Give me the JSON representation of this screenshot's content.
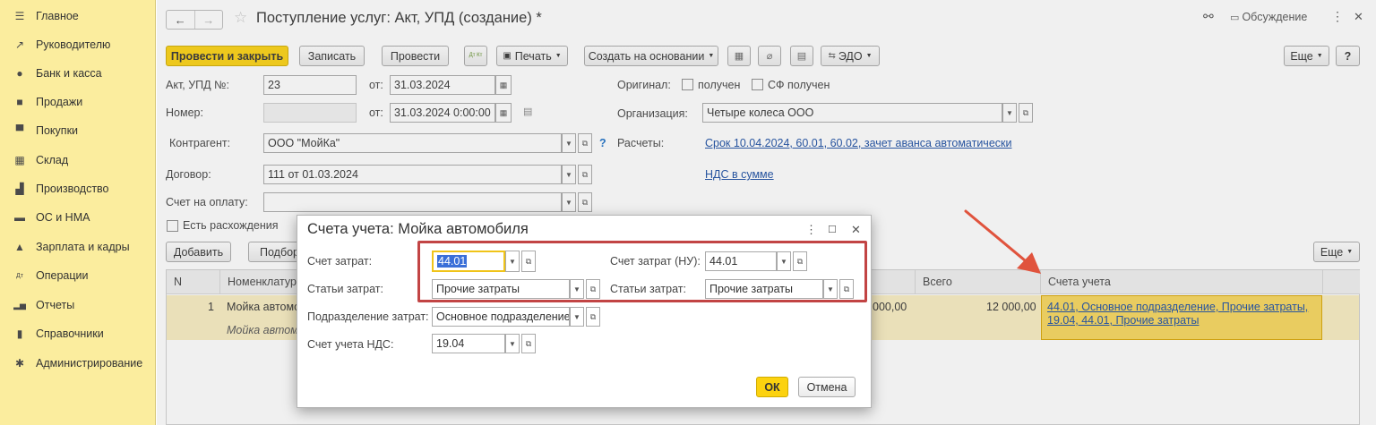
{
  "sidebar": {
    "items": [
      {
        "label": "Главное",
        "icon": "menu-icon",
        "glyph": "☰"
      },
      {
        "label": "Руководителю",
        "icon": "trend-icon",
        "glyph": "↗"
      },
      {
        "label": "Банк и касса",
        "icon": "coin-icon",
        "glyph": "●"
      },
      {
        "label": "Продажи",
        "icon": "bag-icon",
        "glyph": "■"
      },
      {
        "label": "Покупки",
        "icon": "cart-icon",
        "glyph": "▀"
      },
      {
        "label": "Склад",
        "icon": "warehouse-icon",
        "glyph": "▦"
      },
      {
        "label": "Производство",
        "icon": "factory-icon",
        "glyph": "▟"
      },
      {
        "label": "ОС и НМА",
        "icon": "truck-icon",
        "glyph": "▬"
      },
      {
        "label": "Зарплата и кадры",
        "icon": "person-icon",
        "glyph": "▲"
      },
      {
        "label": "Операции",
        "icon": "dt-kt-icon",
        "glyph": "Дт"
      },
      {
        "label": "Отчеты",
        "icon": "bar-chart-icon",
        "glyph": "▂▅"
      },
      {
        "label": "Справочники",
        "icon": "book-icon",
        "glyph": "▮"
      },
      {
        "label": "Администрирование",
        "icon": "gear-icon",
        "glyph": "✱"
      }
    ]
  },
  "header": {
    "title": "Поступление услуг: Акт, УПД (создание) *",
    "discussion": "Обсуждение",
    "back_glyph": "←",
    "forward_glyph": "→",
    "star_glyph": "☆",
    "link_glyph": "⚯",
    "more_glyph": "⋮",
    "close_glyph": "✕"
  },
  "toolbar": {
    "post_close": "Провести и закрыть",
    "save": "Записать",
    "post": "Провести",
    "dtkt": "Дт Кт",
    "print": "Печать",
    "create_based": "Создать на основании",
    "edo": "ЭДО",
    "more": "Еще",
    "help": "?"
  },
  "form": {
    "act_label": "Акт, УПД №:",
    "act_number": "23",
    "from_label": "от:",
    "act_date": "31.03.2024",
    "number_label": "Номер:",
    "number_value": "",
    "number_date": "31.03.2024  0:00:00",
    "contractor_label": "Контрагент:",
    "contractor_value": "ООО \"МойКа\"",
    "contract_label": "Договор:",
    "contract_value": "111 от 01.03.2024",
    "invoice_label": "Счет на оплату:",
    "invoice_value": "",
    "discrepancy_label": "Есть расхождения",
    "original_label": "Оригинал:",
    "received_label": "получен",
    "sf_received_label": "СФ получен",
    "org_label": "Организация:",
    "org_value": "Четыре колеса ООО",
    "settlements_label": "Расчеты:",
    "settlements_link": "Срок 10.04.2024, 60.01, 60.02, зачет аванса автоматически",
    "vat_link": "НДС в сумме",
    "help_q": "?"
  },
  "table_toolbar": {
    "add": "Добавить",
    "select": "Подбор",
    "more": "Еще"
  },
  "table": {
    "columns": [
      "N",
      "Номенклатура",
      "Всего",
      "Счета учета"
    ],
    "rows": [
      {
        "n": "1",
        "item": "Мойка автомо",
        "item_sub": "Мойка автомо",
        "amount": "000,00",
        "total": "12 000,00",
        "accounts": "44.01, Основное подразделение, Прочие затраты, 19.04, 44.01, Прочие затраты"
      }
    ]
  },
  "dialog": {
    "title": "Счета учета: Мойка автомобиля",
    "cost_account_label": "Счет затрат:",
    "cost_account_value": "44.01",
    "cost_items_label": "Статьи затрат:",
    "cost_items_value": "Прочие затраты",
    "cost_account_nu_label": "Счет затрат (НУ):",
    "cost_account_nu_value": "44.01",
    "cost_items_nu_label": "Статьи затрат:",
    "cost_items_nu_value": "Прочие затраты",
    "department_label": "Подразделение затрат:",
    "department_value": "Основное подразделение",
    "vat_account_label": "Счет учета НДС:",
    "vat_account_value": "19.04",
    "ok": "ОК",
    "cancel": "Отмена"
  },
  "colors": {
    "sidebar_bg": "#fbed9e",
    "primary_button": "#fcd20f",
    "link": "#1b4ea3",
    "highlight": "#c24444",
    "arrow": "#e0533d"
  }
}
